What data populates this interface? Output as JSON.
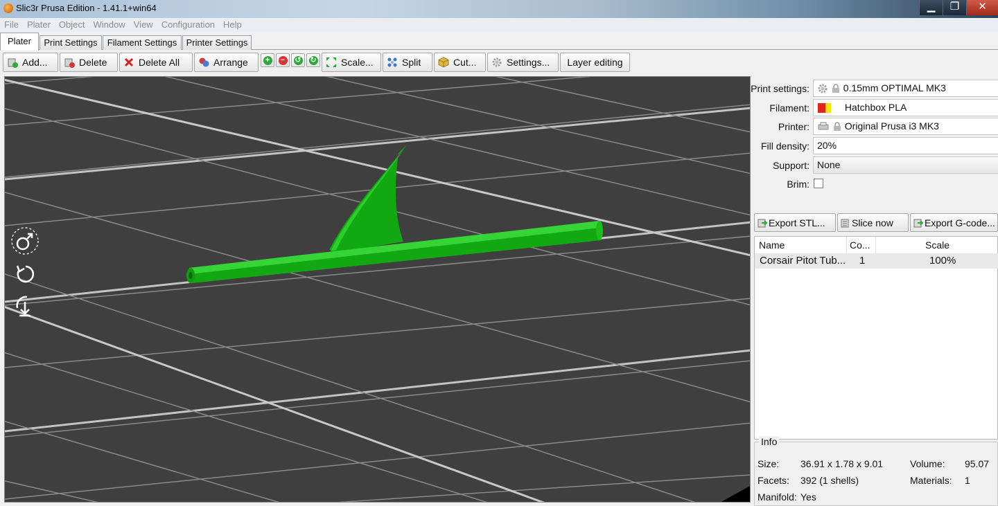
{
  "window": {
    "title": "Slic3r Prusa Edition - 1.41.1+win64",
    "minimize": "▁",
    "maximize": "❐",
    "close": "✕"
  },
  "menu": [
    "File",
    "Plater",
    "Object",
    "Window",
    "View",
    "Configuration",
    "Help"
  ],
  "tabs": [
    "Plater",
    "Print Settings",
    "Filament Settings",
    "Printer Settings"
  ],
  "toolbar": {
    "add": "Add...",
    "delete": "Delete",
    "delete_all": "Delete All",
    "arrange": "Arrange",
    "scale": "Scale...",
    "split": "Split",
    "cut": "Cut...",
    "settings": "Settings...",
    "layer_editing": "Layer editing"
  },
  "settings": {
    "print_label": "Print settings:",
    "print_value": "0.15mm OPTIMAL MK3",
    "filament_label": "Filament:",
    "filament_value": "Hatchbox PLA",
    "printer_label": "Printer:",
    "printer_value": "Original Prusa i3 MK3",
    "fill_label": "Fill density:",
    "fill_value": "20%",
    "support_label": "Support:",
    "support_value": "None",
    "brim_label": "Brim:"
  },
  "actions": {
    "export_stl": "Export STL...",
    "slice_now": "Slice now",
    "export_gcode": "Export G-code..."
  },
  "object_list": {
    "headers": {
      "name": "Name",
      "copies": "Co...",
      "scale": "Scale"
    },
    "rows": [
      {
        "name": "Corsair Pitot Tub...",
        "copies": "1",
        "scale": "100%"
      }
    ]
  },
  "info": {
    "legend": "Info",
    "size_label": "Size:",
    "size_value": "36.91 x 1.78 x 9.01",
    "volume_label": "Volume:",
    "volume_value": "95.07",
    "facets_label": "Facets:",
    "facets_value": "392 (1 shells)",
    "materials_label": "Materials:",
    "materials_value": "1",
    "manifold_label": "Manifold:",
    "manifold_value": "Yes"
  },
  "colors": {
    "model": "#12b012",
    "bed": "#3f3f3f",
    "grid": "#8a8a8a",
    "swatch_red": "#e8221d",
    "swatch_yellow": "#f4e40a"
  }
}
